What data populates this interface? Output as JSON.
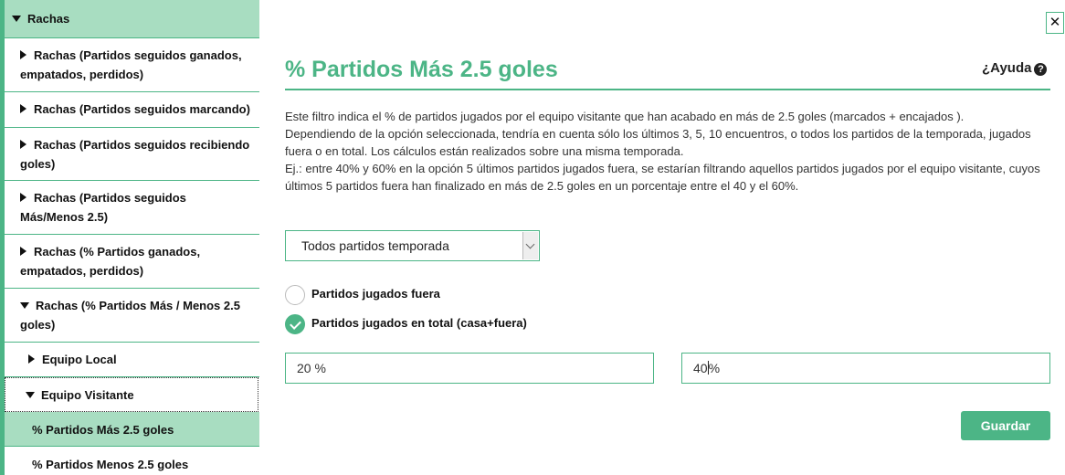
{
  "sidebar": {
    "header": "Rachas",
    "items": [
      {
        "label": "Rachas (Partidos seguidos ganados, empatados, perdidos)"
      },
      {
        "label": "Rachas (Partidos seguidos marcando)"
      },
      {
        "label": "Rachas (Partidos seguidos recibiendo goles)"
      },
      {
        "label": "Rachas (Partidos seguidos Más/Menos 2.5)"
      },
      {
        "label": "Rachas (% Partidos ganados, empatados, perdidos)"
      },
      {
        "label": "Rachas (% Partidos Más / Menos 2.5 goles)"
      },
      {
        "label": "Equipo Local"
      },
      {
        "label": "Equipo Visitante"
      },
      {
        "label": "% Partidos Más 2.5 goles"
      },
      {
        "label": "% Partidos Menos 2.5 goles"
      }
    ]
  },
  "main": {
    "close_label": "✕",
    "title": "% Partidos Más 2.5 goles",
    "help_label": "¿Ayuda",
    "help_icon": "?",
    "description": [
      "Este filtro indica el % de partidos jugados por el equipo visitante que han acabado en más de 2.5 goles (marcados + encajados ).",
      "Dependiendo de la opción seleccionada, tendría en cuenta sólo los últimos 3, 5, 10 encuentros, o todos los partidos de la temporada, jugados fuera o en total. Los cálculos están realizados sobre una misma temporada.",
      "Ej.: entre 40% y 60% en la opción 5 últimos partidos jugados fuera, se estarían filtrando aquellos partidos jugados por el equipo visitante, cuyos últimos 5 partidos fuera han finalizado en más de 2.5 goles en un porcentaje entre el 40 y el 60%."
    ],
    "select_value": "Todos partidos temporada",
    "radio_away": "Partidos jugados fuera",
    "radio_total": "Partidos jugados en total (casa+fuera)",
    "min_value": "20 %",
    "max_value_before_caret": "40",
    "max_value_after_caret": "%",
    "save_label": "Guardar"
  },
  "colors": {
    "accent": "#4cb586",
    "selected_bg": "#a8ddc1"
  }
}
